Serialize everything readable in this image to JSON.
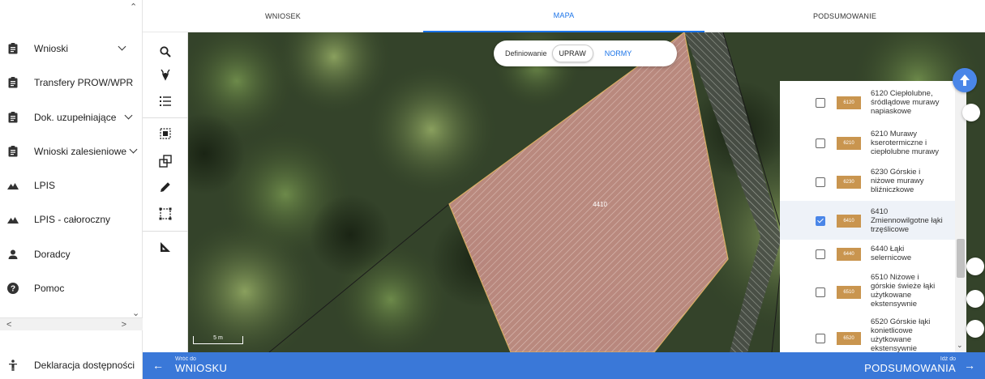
{
  "sidebar": {
    "items": [
      {
        "label": "Wnioski",
        "icon": "clipboard-icon",
        "has_chevron": true
      },
      {
        "label": "Transfery PROW/WPR",
        "icon": "clipboard-icon",
        "has_chevron": false
      },
      {
        "label": "Dok. uzupełniające",
        "icon": "clipboard-icon",
        "has_chevron": true
      },
      {
        "label": "Wnioski zalesieniowe",
        "icon": "clipboard-icon",
        "has_chevron": true
      },
      {
        "label": "LPIS",
        "icon": "terrain-icon",
        "has_chevron": false
      },
      {
        "label": "LPIS - całoroczny",
        "icon": "terrain-icon",
        "has_chevron": false
      },
      {
        "label": "Doradcy",
        "icon": "person-icon",
        "has_chevron": false
      },
      {
        "label": "Pomoc",
        "icon": "help-icon",
        "has_chevron": false
      }
    ],
    "footer": {
      "label": "Deklaracja dostępności",
      "icon": "accessibility-icon"
    }
  },
  "tabs": [
    {
      "label": "WNIOSEK",
      "active": false
    },
    {
      "label": "MAPA",
      "active": true
    },
    {
      "label": "PODSUMOWANIE",
      "active": false
    }
  ],
  "tools": [
    "search-icon",
    "pin-icon",
    "list-icon",
    "select-area-icon",
    "copy-icon",
    "pencil-icon",
    "crop-icon",
    "measure-angle-icon"
  ],
  "map": {
    "toggle": {
      "label": "Definiowanie",
      "option_selected": "UPRAW",
      "option_other": "NORMY"
    },
    "parcel_label": "4410",
    "hatch_code": "6410",
    "scale_text": "5 m"
  },
  "legend": {
    "items": [
      {
        "code": "6120",
        "text": "6120 Ciepłolubne, śródlądowe murawy napiaskowe",
        "checked": false
      },
      {
        "code": "6210",
        "text": "6210 Murawy kserotermiczne i ciepłolubne murawy",
        "checked": false
      },
      {
        "code": "6230",
        "text": "6230 Górskie i niżowe murawy bliźniczkowe",
        "checked": false
      },
      {
        "code": "6410",
        "text": "6410 Zmiennowilgotne łąki trzęślicowe",
        "checked": true
      },
      {
        "code": "6440",
        "text": "6440 Łąki selernicowe",
        "checked": false
      },
      {
        "code": "6510",
        "text": "6510 Niżowe i górskie świeże łąki użytkowane ekstensywnie",
        "checked": false
      },
      {
        "code": "6520",
        "text": "6520 Górskie łąki konietlicowe użytkowane ekstensywnie",
        "checked": false
      }
    ]
  },
  "bottombar": {
    "back_small": "Wróć do",
    "back_big": "WNIOSKU",
    "next_small": "Idź do",
    "next_big": "PODSUMOWANIA"
  },
  "colors": {
    "accent": "#3a78d8",
    "swatch": "#c9954f",
    "parcel": "#c98a80"
  }
}
